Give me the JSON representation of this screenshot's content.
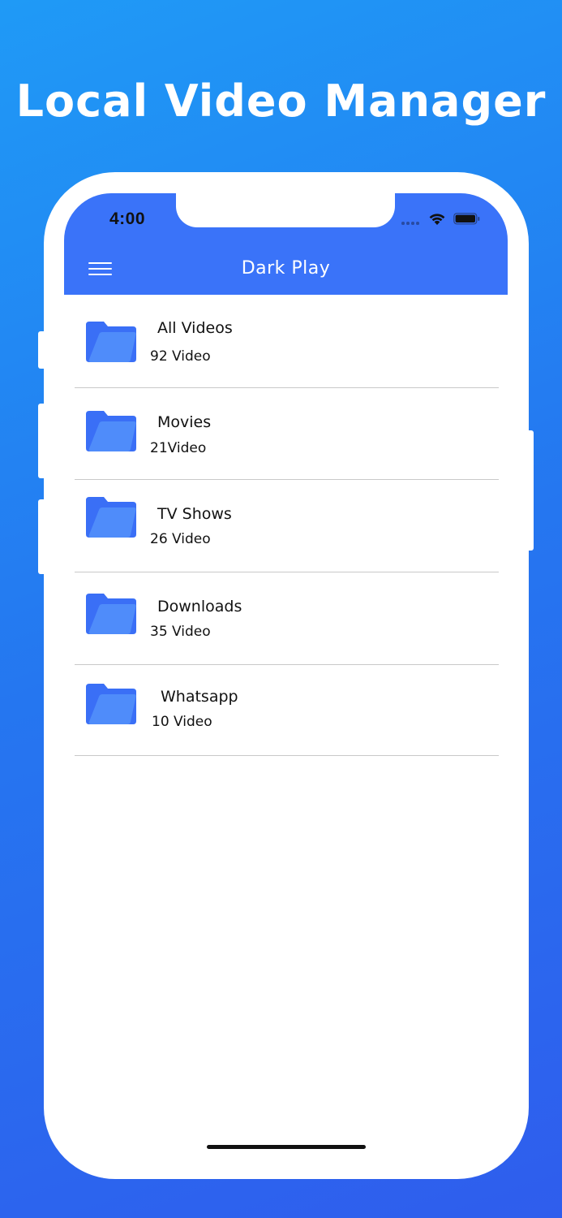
{
  "headline": "Local Video Manager",
  "status_bar": {
    "time": "4:00",
    "icons": [
      "signal-dots-icon",
      "wifi-icon",
      "battery-icon"
    ]
  },
  "app_bar": {
    "title": "Dark Play",
    "menu_icon": "hamburger-menu-icon"
  },
  "colors": {
    "background_top": "#1f9af6",
    "background_bottom": "#2f5ded",
    "header": "#3a73f9",
    "folder_back": "#3a6ff6",
    "folder_front": "#4f8cfa"
  },
  "folders": [
    {
      "name": "All Videos",
      "count": "92 Video",
      "icon": "folder-icon"
    },
    {
      "name": "Movies",
      "count": "21Video",
      "icon": "folder-icon"
    },
    {
      "name": "TV Shows",
      "count": "26 Video",
      "icon": "folder-icon"
    },
    {
      "name": "Downloads",
      "count": "35 Video",
      "icon": "folder-icon"
    },
    {
      "name": "Whatsapp",
      "count": "10 Video",
      "icon": "folder-icon"
    }
  ]
}
